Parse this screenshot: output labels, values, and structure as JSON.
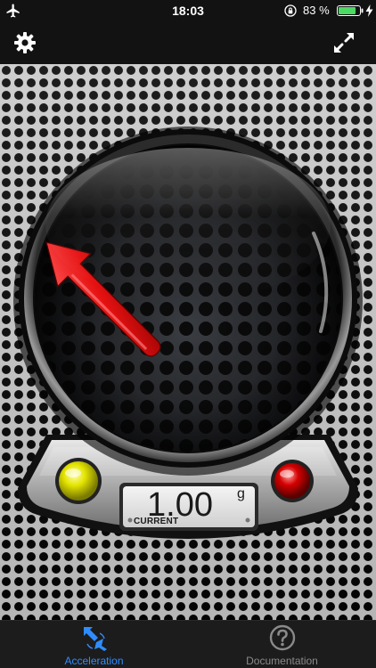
{
  "status_bar": {
    "time": "18:03",
    "battery_percent_text": "83 %",
    "battery_level": 0.83,
    "icons": [
      "airplane-mode-icon",
      "orientation-lock-icon",
      "battery-icon",
      "charging-bolt-icon"
    ],
    "battery_color": "#4cd964"
  },
  "toolbar": {
    "icons": [
      "gear-icon",
      "expand-icon"
    ]
  },
  "gauge": {
    "readout_value": "1.00",
    "readout_unit": "g",
    "readout_label": "CURRENT",
    "arrow_color": "#e61111",
    "indicator_left_color": "#d6d600",
    "indicator_right_color": "#cc0000"
  },
  "tab_bar": {
    "accent_color": "#2f8cff",
    "tabs": [
      {
        "label": "Acceleration",
        "icon": "acceleration-icon",
        "active": true
      },
      {
        "label": "Documentation",
        "icon": "question-mark-icon",
        "active": false
      }
    ]
  }
}
